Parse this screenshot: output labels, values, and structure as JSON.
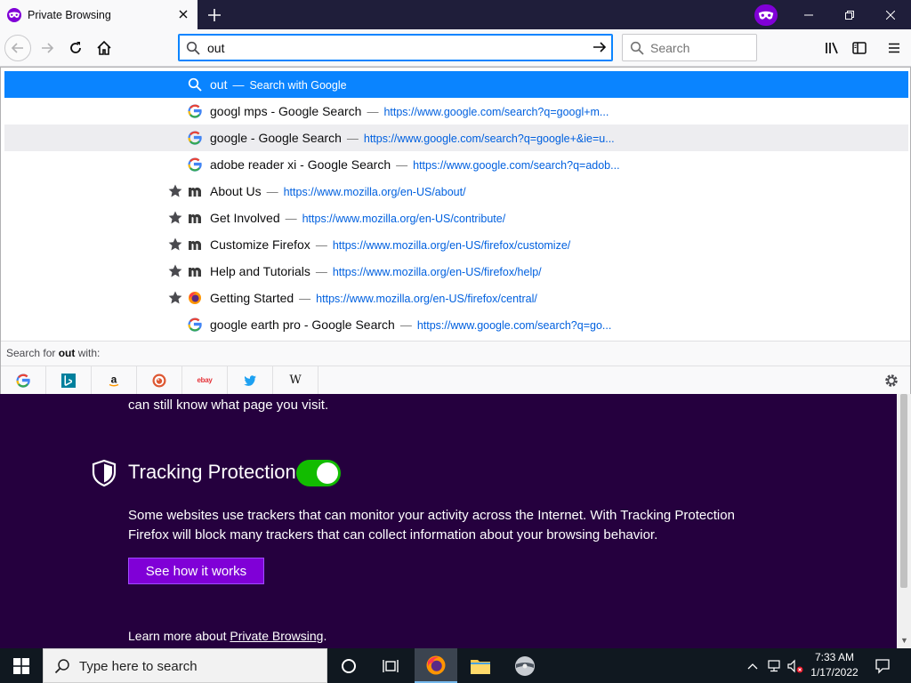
{
  "tab": {
    "title": "Private Browsing"
  },
  "urlbar": {
    "value": "out"
  },
  "searchbar": {
    "placeholder": "Search"
  },
  "suggestions": [
    {
      "title": "out",
      "action": "Search with Google",
      "kind": "search",
      "state": "selected"
    },
    {
      "title": "googl mps - Google Search",
      "url": "https://www.google.com/search?q=googl+m...",
      "kind": "google"
    },
    {
      "title": "google - Google Search",
      "url": "https://www.google.com/search?q=google+&ie=u...",
      "kind": "google",
      "state": "hover"
    },
    {
      "title": "adobe reader xi - Google Search",
      "url": "https://www.google.com/search?q=adob...",
      "kind": "google"
    },
    {
      "title": "About Us",
      "url": "https://www.mozilla.org/en-US/about/",
      "kind": "mozilla",
      "starred": true
    },
    {
      "title": "Get Involved",
      "url": "https://www.mozilla.org/en-US/contribute/",
      "kind": "mozilla",
      "starred": true
    },
    {
      "title": "Customize Firefox",
      "url": "https://www.mozilla.org/en-US/firefox/customize/",
      "kind": "mozilla",
      "starred": true
    },
    {
      "title": "Help and Tutorials",
      "url": "https://www.mozilla.org/en-US/firefox/help/",
      "kind": "mozilla",
      "starred": true
    },
    {
      "title": "Getting Started",
      "url": "https://www.mozilla.org/en-US/firefox/central/",
      "kind": "firefox",
      "starred": true
    },
    {
      "title": "google earth pro - Google Search",
      "url": "https://www.google.com/search?q=go...",
      "kind": "google"
    }
  ],
  "separator": "—",
  "oneoff": {
    "prefix": "Search for ",
    "term": "out",
    "suffix": " with:"
  },
  "engines": [
    "google-icon",
    "bing-icon",
    "amazon-icon",
    "duckduckgo-icon",
    "ebay-icon",
    "twitter-icon",
    "wikipedia-icon"
  ],
  "engine_labels": {
    "ebay": "ebay",
    "wiki": "W"
  },
  "page": {
    "top_text": "can still know what page you visit.",
    "tp_title": "Tracking Protection",
    "tp_enabled": true,
    "tp_desc": "Some websites use trackers that can monitor your activity across the Internet. With Tracking Protection Firefox will block many trackers that can collect information about your browsing behavior.",
    "button": "See how it works",
    "learn_prefix": "Learn more about ",
    "learn_link": "Private Browsing",
    "learn_suffix": "."
  },
  "taskbar": {
    "search_placeholder": "Type here to search",
    "time": "7:33 AM",
    "date": "1/17/2022"
  },
  "colors": {
    "accent": "#0a84ff",
    "private_purple": "#8000d7",
    "page_bg": "#25003e",
    "toggle_on": "#12bc00"
  }
}
